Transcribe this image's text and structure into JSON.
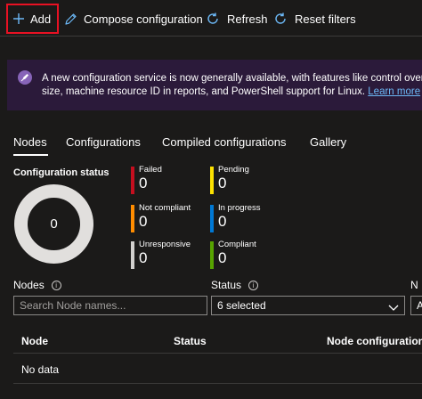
{
  "toolbar": {
    "add_label": "Add",
    "compose_label": "Compose configuration",
    "refresh_label": "Refresh",
    "reset_label": "Reset filters"
  },
  "banner": {
    "line1": "A new configuration service is now generally available, with features like control over drift",
    "line2": "size, machine resource ID in reports, and PowerShell support for Linux.",
    "link": "Learn more"
  },
  "tabs": [
    {
      "label": "Nodes",
      "selected": true
    },
    {
      "label": "Configurations",
      "selected": false
    },
    {
      "label": "Compiled configurations",
      "selected": false
    },
    {
      "label": "Gallery",
      "selected": false
    }
  ],
  "config_status": {
    "title": "Configuration status",
    "total": "0",
    "items": [
      {
        "label": "Failed",
        "value": "0",
        "color": "#c50f1f"
      },
      {
        "label": "Pending",
        "value": "0",
        "color": "#fce100"
      },
      {
        "label": "Not compliant",
        "value": "0",
        "color": "#ff8c00"
      },
      {
        "label": "In progress",
        "value": "0",
        "color": "#0078d4"
      },
      {
        "label": "Unresponsive",
        "value": "0",
        "color": "#d2d0ce"
      },
      {
        "label": "Compliant",
        "value": "0",
        "color": "#57a300"
      }
    ]
  },
  "filters": {
    "nodes_label": "Nodes",
    "nodes_placeholder": "Search Node names...",
    "status_label": "Status",
    "status_value": "6 selected",
    "third_label": "N",
    "third_value": "A"
  },
  "table": {
    "columns": [
      "Node",
      "Status",
      "Node configuration"
    ],
    "empty_text": "No data"
  }
}
